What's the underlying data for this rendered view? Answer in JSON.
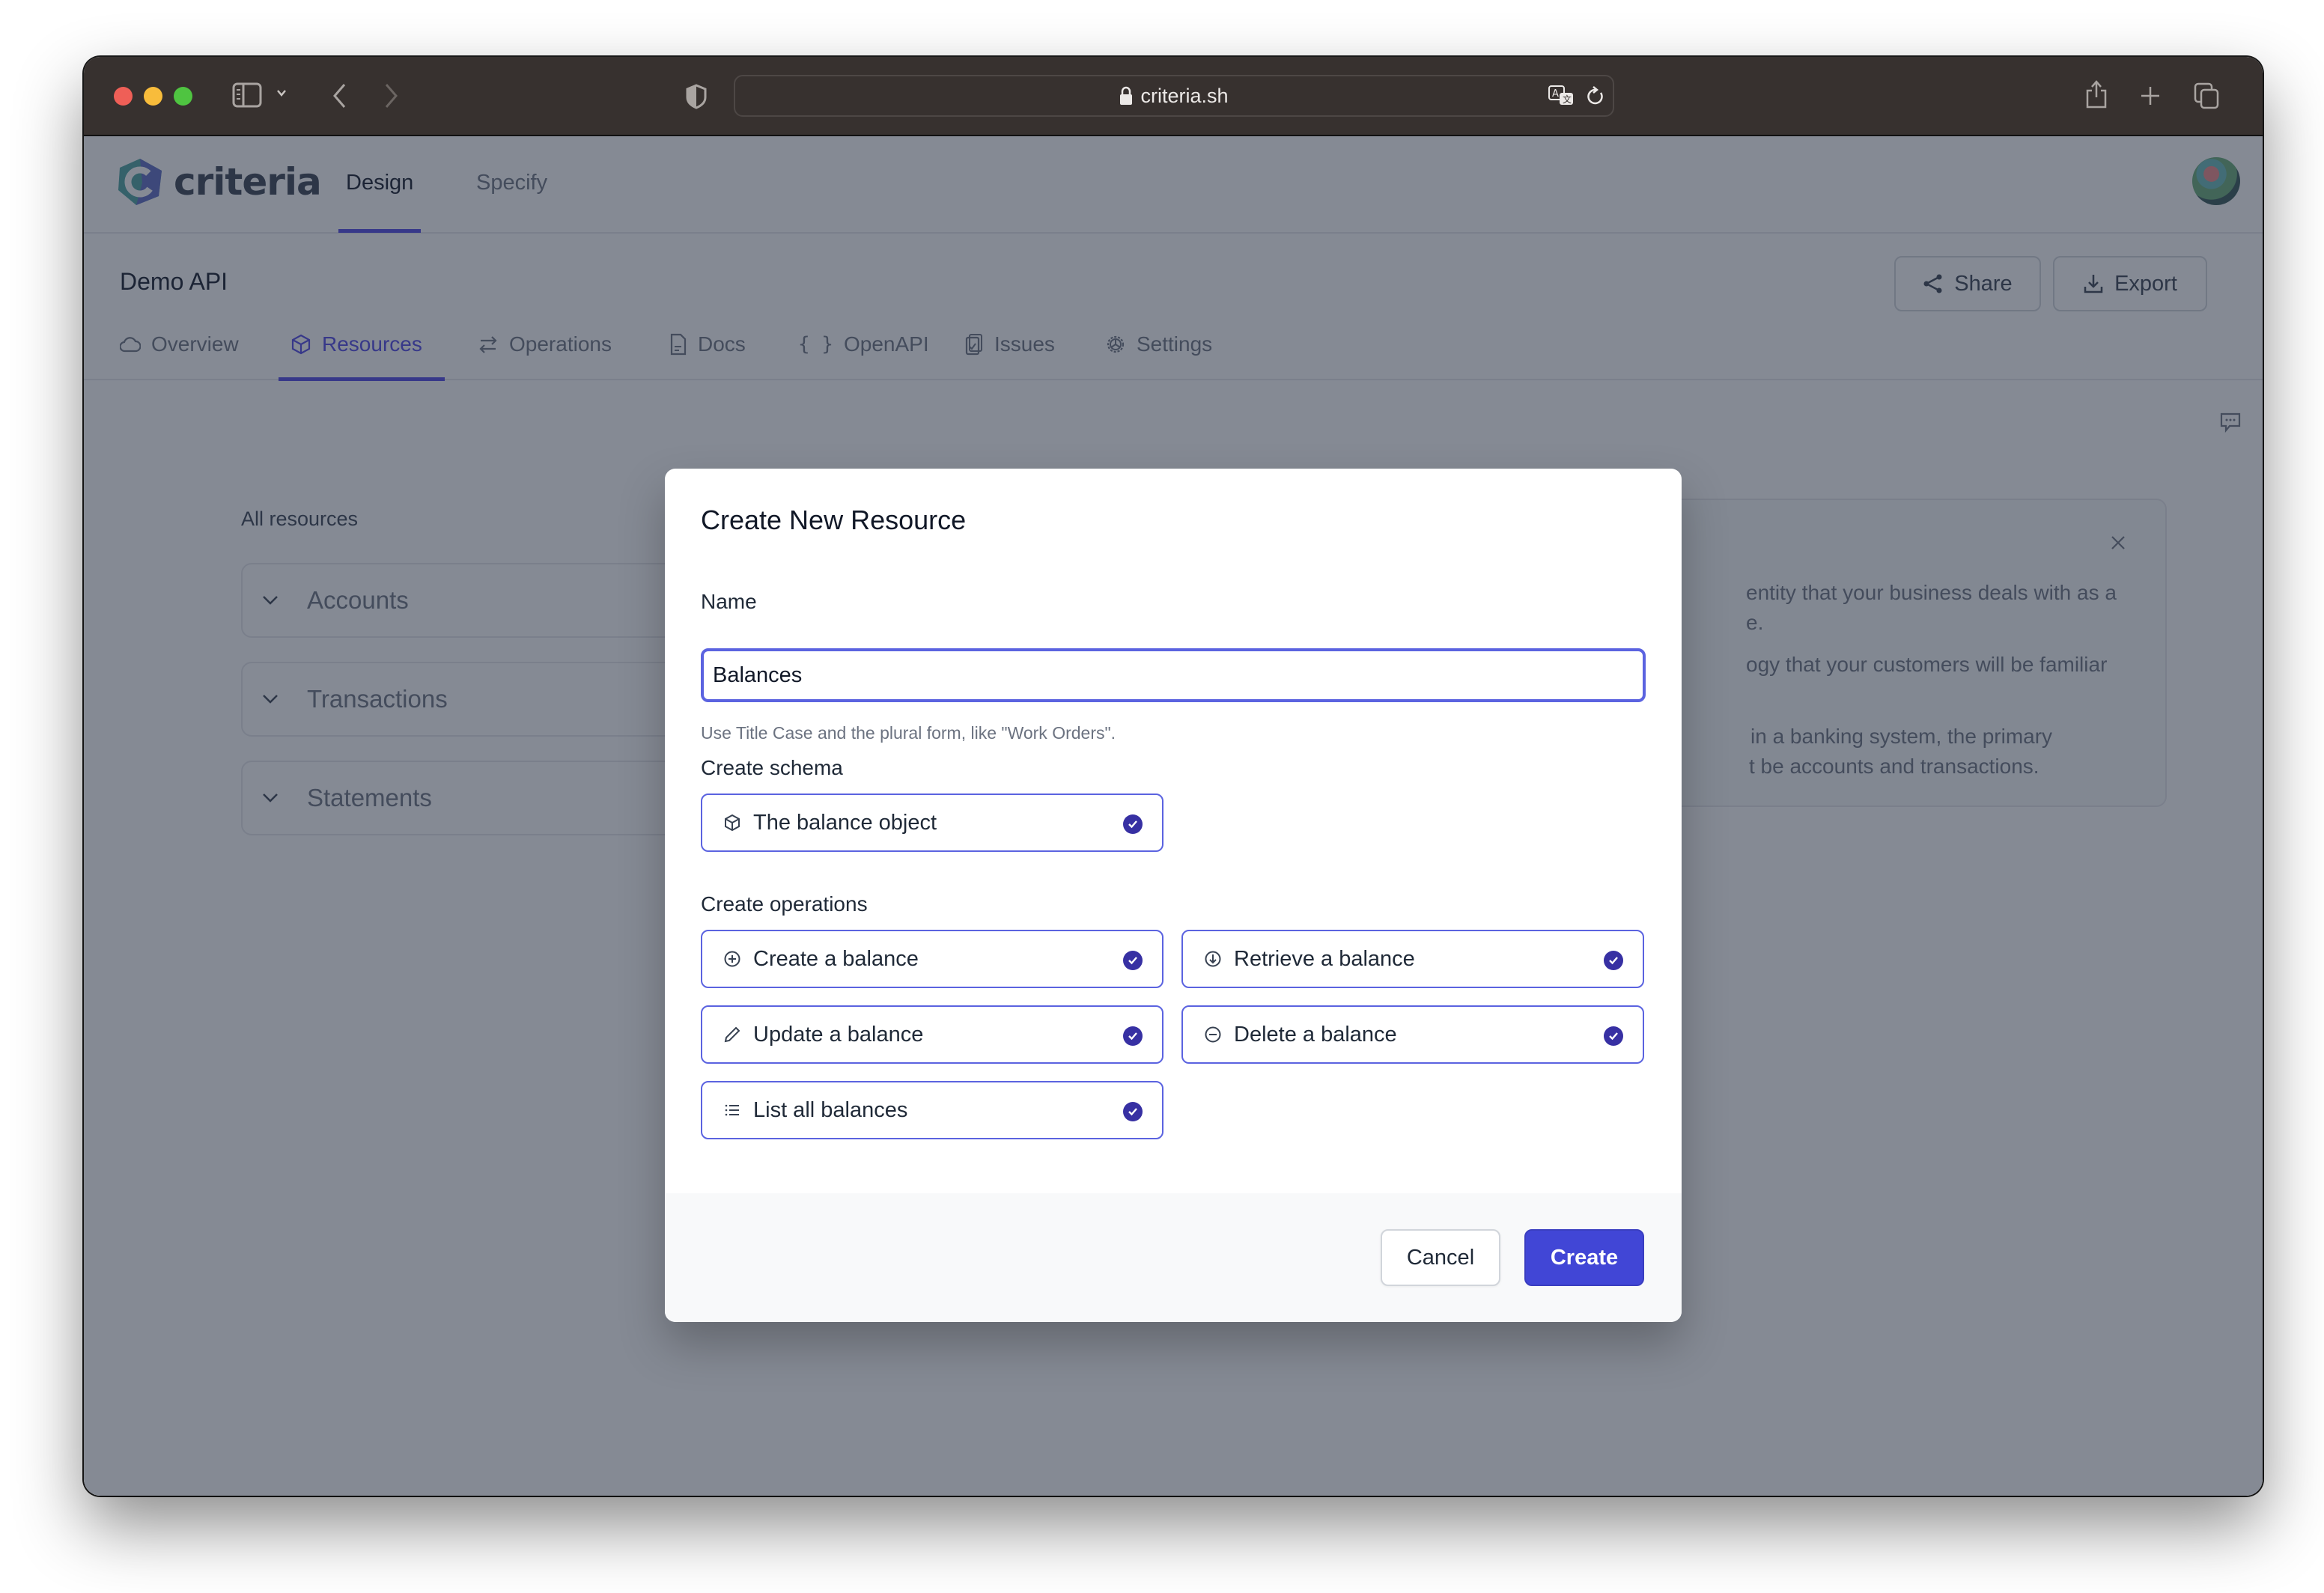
{
  "browser": {
    "url": "criteria.sh"
  },
  "app": {
    "brand": "criteria",
    "nav_tabs": [
      {
        "label": "Design",
        "active": true
      },
      {
        "label": "Specify",
        "active": false
      }
    ],
    "project_title": "Demo API",
    "header_buttons": {
      "share": "Share",
      "export": "Export"
    },
    "sub_tabs": [
      {
        "label": "Overview",
        "icon": "cloud-icon",
        "active": false
      },
      {
        "label": "Resources",
        "icon": "cube-icon",
        "active": true
      },
      {
        "label": "Operations",
        "icon": "arrows-icon",
        "active": false
      },
      {
        "label": "Docs",
        "icon": "document-icon",
        "active": false
      },
      {
        "label": "OpenAPI",
        "icon": "braces-icon",
        "active": false
      },
      {
        "label": "Issues",
        "icon": "clipboard-icon",
        "active": false
      },
      {
        "label": "Settings",
        "icon": "gear-icon",
        "active": false
      }
    ],
    "resources": {
      "heading": "All resources",
      "items": [
        "Accounts",
        "Transactions",
        "Statements"
      ]
    },
    "info_panel": {
      "lines": [
        "entity that your business deals with as a",
        "e.",
        "ogy that your customers will be familiar",
        "in a banking system, the primary",
        "t be accounts and transactions."
      ]
    }
  },
  "modal": {
    "title": "Create New Resource",
    "name_label": "Name",
    "name_value": "Balances",
    "name_hint": "Use Title Case and the plural form, like \"Work Orders\".",
    "schema_label": "Create schema",
    "schema_options": [
      {
        "label": "The balance object",
        "icon": "cube-icon",
        "checked": true
      }
    ],
    "operations_label": "Create operations",
    "operation_options": [
      {
        "label": "Create a balance",
        "icon": "plus-circle-icon",
        "checked": true
      },
      {
        "label": "Retrieve a balance",
        "icon": "arrow-down-circle-icon",
        "checked": true
      },
      {
        "label": "Update a balance",
        "icon": "pencil-icon",
        "checked": true
      },
      {
        "label": "Delete a balance",
        "icon": "minus-circle-icon",
        "checked": true
      },
      {
        "label": "List all balances",
        "icon": "list-icon",
        "checked": true
      }
    ],
    "cancel_label": "Cancel",
    "create_label": "Create"
  },
  "colors": {
    "accent": "#4f46e5",
    "primary_button": "#4146d6",
    "check": "#3730a3",
    "titlebar": "#37312f"
  }
}
